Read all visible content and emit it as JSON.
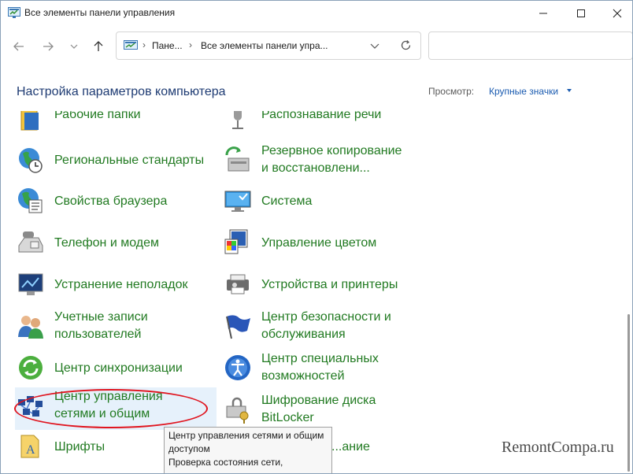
{
  "window": {
    "title": "Все элементы панели управления"
  },
  "address": {
    "crumbs": [
      "Пане...",
      "Все элементы панели упра..."
    ]
  },
  "search": {
    "placeholder": ""
  },
  "header": {
    "title": "Настройка параметров компьютера",
    "view_label": "Просмотр:",
    "view_value": "Крупные значки"
  },
  "items_left": [
    {
      "label": "Рабочие папки",
      "icon": "work-folders-icon"
    },
    {
      "label": "Региональные стандарты",
      "icon": "region-globe-icon"
    },
    {
      "label": "Свойства браузера",
      "icon": "internet-options-icon"
    },
    {
      "label": "Телефон и модем",
      "icon": "phone-modem-icon"
    },
    {
      "label": "Устранение неполадок",
      "icon": "troubleshooting-icon"
    },
    {
      "label": "Учетные записи пользователей",
      "line1": "Учетные записи",
      "line2": "пользователей",
      "icon": "user-accounts-icon"
    },
    {
      "label": "Центр синхронизации",
      "icon": "sync-center-icon"
    },
    {
      "label": "Центр управления сетями и общим",
      "line1": "Центр управления",
      "line2": "сетями и общим",
      "icon": "network-center-icon"
    },
    {
      "label": "Шрифты",
      "icon": "fonts-icon"
    }
  ],
  "items_right": [
    {
      "label": "Распознавание речи",
      "icon": "speech-recognition-icon"
    },
    {
      "label": "Резервное копирование и восстановлени...",
      "line1": "Резервное копирование",
      "line2": "и восстановлени...",
      "icon": "backup-restore-icon"
    },
    {
      "label": "Система",
      "icon": "system-icon"
    },
    {
      "label": "Управление цветом",
      "icon": "color-management-icon"
    },
    {
      "label": "Устройства и принтеры",
      "icon": "devices-printers-icon"
    },
    {
      "label": "Центр безопасности и обслуживания",
      "line1": "Центр безопасности и",
      "line2": "обслуживания",
      "icon": "security-flag-icon"
    },
    {
      "label": "Центр специальных возможностей",
      "line1": "Центр специальных",
      "line2": "возможностей",
      "icon": "ease-of-access-icon"
    },
    {
      "label": "Шифрование диска BitLocker",
      "line1": "Шифрование диска",
      "line2": "BitLocker",
      "icon": "bitlocker-icon"
    },
    {
      "label": "...ание",
      "icon": "partially-hidden-icon"
    }
  ],
  "tooltip": {
    "line1": "Центр управления сетями и общим",
    "line2": "доступом",
    "line3": "Проверка состояния сети,"
  },
  "watermark": "RemontCompa.ru",
  "colors": {
    "link": "#217a21",
    "heading": "#1e3b73",
    "highlight": "#e6f1fb",
    "annotation": "#e0141e"
  }
}
